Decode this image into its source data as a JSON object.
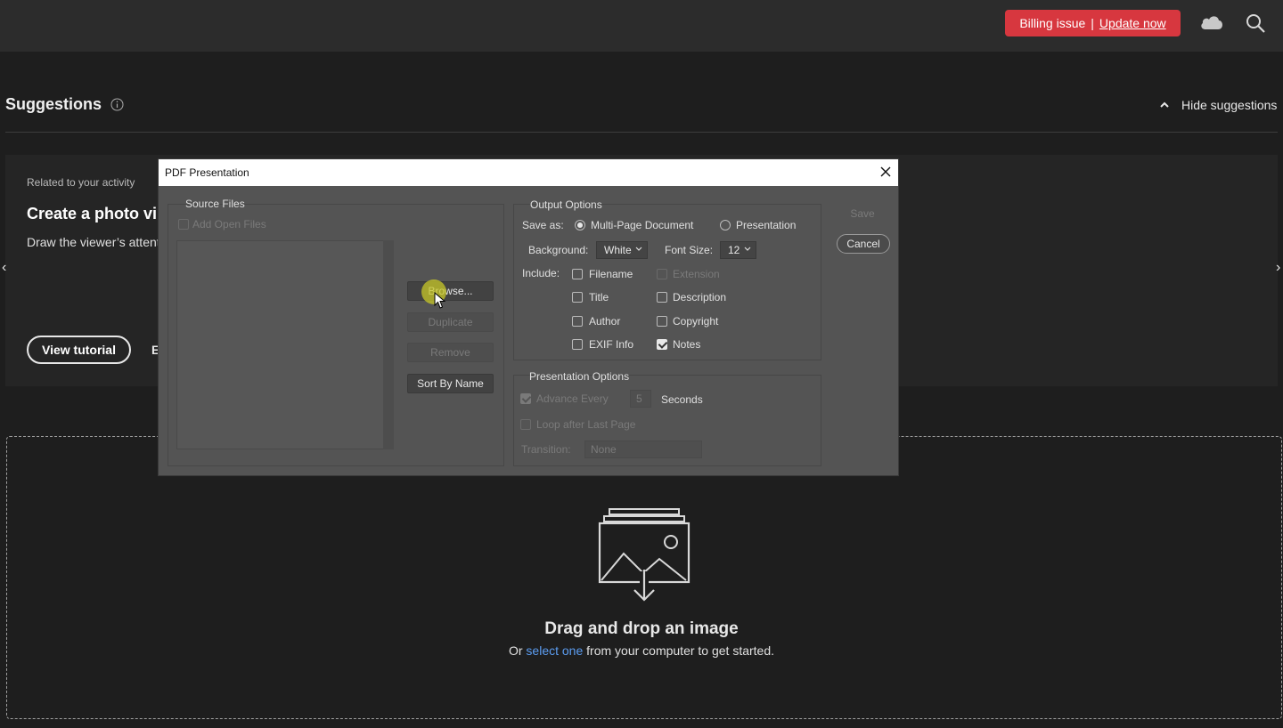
{
  "topbar": {
    "billing_text": "Billing issue",
    "billing_sep": "|",
    "update_link": "Update now",
    "colors": {
      "bg": "#2c2c2c",
      "billing_bg": "#d7373f"
    }
  },
  "suggestions": {
    "title": "Suggestions",
    "hide_label": "Hide suggestions",
    "card": {
      "related": "Related to your activity",
      "title": "Create a photo vi",
      "description": "Draw the viewer’s attent",
      "button": "View tutorial",
      "extra": "E"
    }
  },
  "dropzone": {
    "title": "Drag and drop an image",
    "sub_prefix": "Or",
    "sub_link": "select one",
    "sub_suffix": "from your computer to get started."
  },
  "dialog": {
    "title": "PDF Presentation",
    "source_files": {
      "label": "Source Files",
      "add_open_files": "Add Open Files",
      "buttons": {
        "browse": "Browse...",
        "duplicate": "Duplicate",
        "remove": "Remove",
        "sort": "Sort By Name"
      }
    },
    "output": {
      "label": "Output Options",
      "save_as_label": "Save as:",
      "multi_page": "Multi-Page Document",
      "presentation": "Presentation",
      "save_as_selected": "Multi-Page Document",
      "background_label": "Background:",
      "background_value": "White",
      "font_size_label": "Font Size:",
      "font_size_value": "12",
      "include_label": "Include:",
      "include": {
        "filename": {
          "label": "Filename",
          "checked": false
        },
        "extension": {
          "label": "Extension",
          "checked": false
        },
        "title": {
          "label": "Title",
          "checked": false
        },
        "description": {
          "label": "Description",
          "checked": false
        },
        "author": {
          "label": "Author",
          "checked": false
        },
        "copyright": {
          "label": "Copyright",
          "checked": false
        },
        "exif": {
          "label": "EXIF Info",
          "checked": false
        },
        "notes": {
          "label": "Notes",
          "checked": true
        }
      }
    },
    "presentation_options": {
      "label": "Presentation Options",
      "advance_every": "Advance Every",
      "seconds_value": "5",
      "seconds_label": "Seconds",
      "loop": "Loop after Last Page",
      "transition_label": "Transition:",
      "transition_value": "None"
    },
    "actions": {
      "save": "Save",
      "cancel": "Cancel"
    }
  }
}
